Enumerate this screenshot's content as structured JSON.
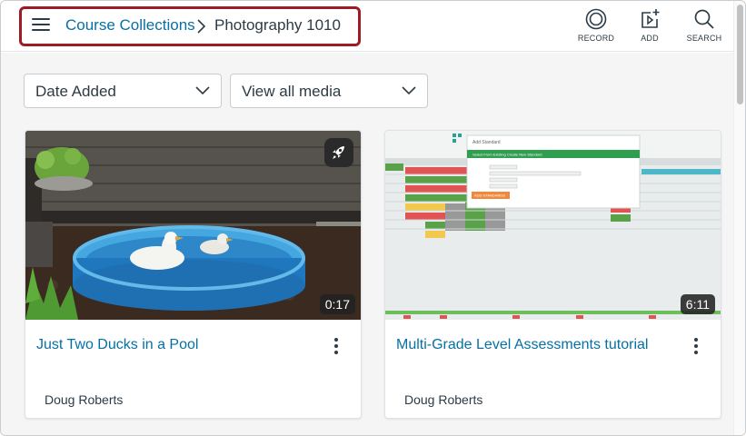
{
  "breadcrumb": {
    "parent_label": "Course Collections",
    "current_label": "Photography 1010"
  },
  "toolbar": {
    "record_label": "RECORD",
    "add_label": "ADD",
    "search_label": "SEARCH"
  },
  "filters": {
    "sort_value": "Date Added",
    "media_value": "View all media"
  },
  "cards": [
    {
      "title": "Just Two Ducks in a Pool",
      "duration": "0:17",
      "author": "Doug Roberts"
    },
    {
      "title": "Multi-Grade Level Assessments tutorial",
      "duration": "6:11",
      "author": "Doug Roberts",
      "thumb_text": {
        "dialog_title": "Add Standard",
        "tab_existing": "Select From Existing",
        "tab_new": "Create New Standard",
        "add_button": "ADD STANDARDS"
      }
    }
  ],
  "colors": {
    "link": "#0770a3",
    "text": "#2d3b45",
    "highlight": "#9e1b25"
  }
}
